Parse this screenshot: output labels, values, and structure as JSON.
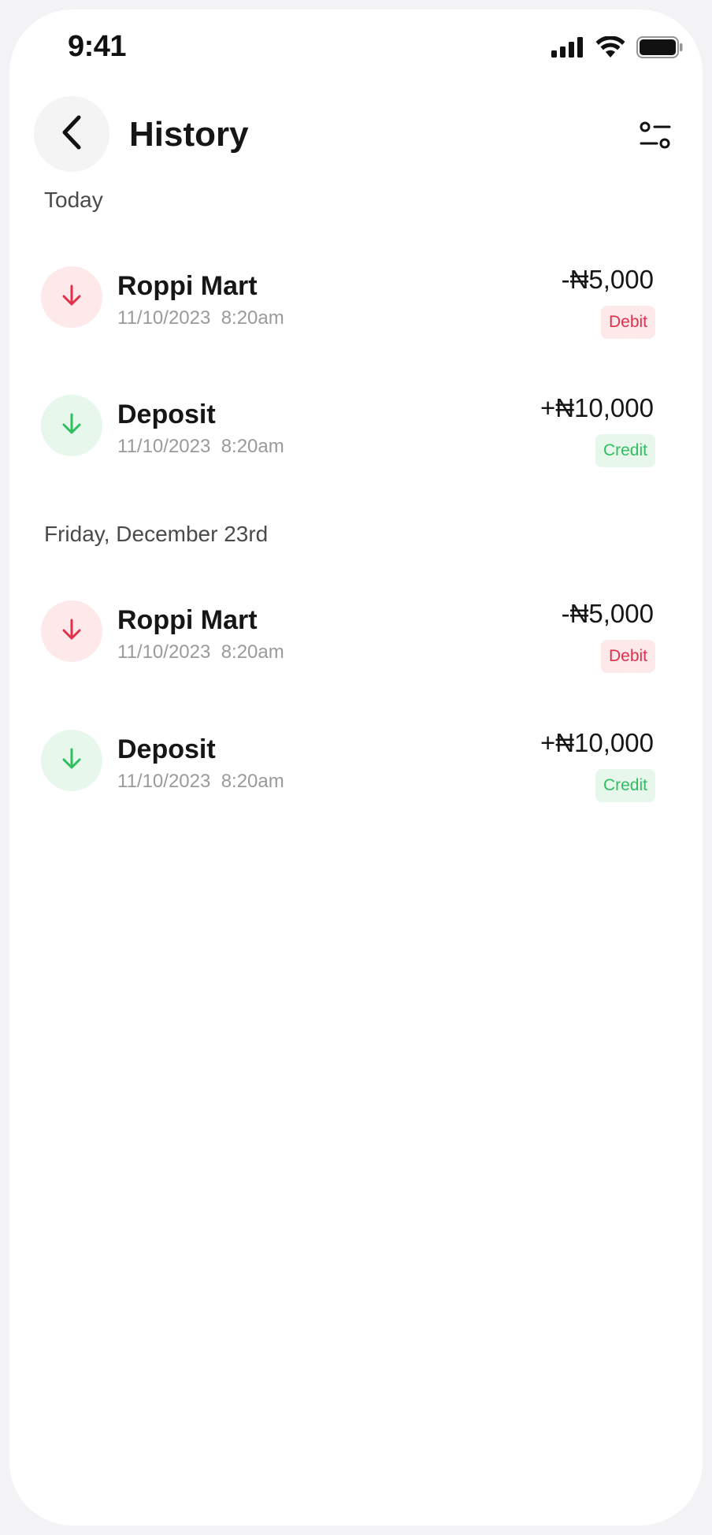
{
  "status_bar": {
    "time": "9:41",
    "icons": [
      "cellular-signal-icon",
      "wifi-icon",
      "battery-icon"
    ]
  },
  "header": {
    "back_icon": "chevron-left-icon",
    "title": "History",
    "filter_icon": "filter-sliders-icon"
  },
  "colors": {
    "debit": "#e0304a",
    "debit_bg": "#fde8ea",
    "credit": "#2fbf5e",
    "credit_bg": "#e7f7ec"
  },
  "sections": [
    {
      "label": "Today",
      "transactions": [
        {
          "name": "Roppi Mart",
          "date": "11/10/2023",
          "time": "8:20am",
          "amount": "-₦5,000",
          "type": "Debit",
          "icon": "arrow-down-icon"
        },
        {
          "name": "Deposit",
          "date": "11/10/2023",
          "time": "8:20am",
          "amount": "+₦10,000",
          "type": "Credit",
          "icon": "arrow-down-icon"
        }
      ]
    },
    {
      "label": "Friday, December 23rd",
      "transactions": [
        {
          "name": "Roppi Mart",
          "date": "11/10/2023",
          "time": "8:20am",
          "amount": "-₦5,000",
          "type": "Debit",
          "icon": "arrow-down-icon"
        },
        {
          "name": "Deposit",
          "date": "11/10/2023",
          "time": "8:20am",
          "amount": "+₦10,000",
          "type": "Credit",
          "icon": "arrow-down-icon"
        }
      ]
    }
  ]
}
